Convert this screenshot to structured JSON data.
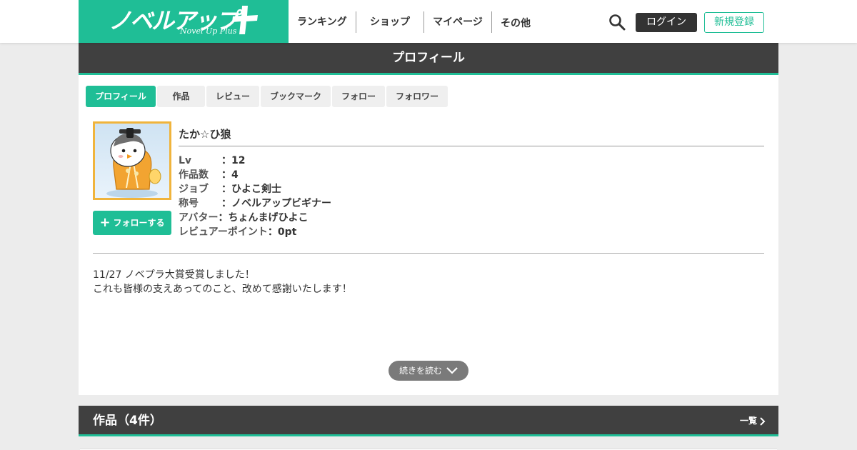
{
  "header": {
    "logo": {
      "main": "ノベルアップ",
      "sub": "Novel Up Plus"
    },
    "nav": [
      {
        "label": "ランキング"
      },
      {
        "label": "ショップ"
      },
      {
        "label": "マイページ"
      },
      {
        "label": "その他"
      }
    ],
    "login_label": "ログイン",
    "register_label": "新規登録",
    "accent_color": "#1fbe96"
  },
  "profile_header": {
    "title": "プロフィール"
  },
  "tabs": [
    {
      "label": "プロフィール",
      "active": true
    },
    {
      "label": "作品"
    },
    {
      "label": "レビュー"
    },
    {
      "label": "ブックマーク"
    },
    {
      "label": "フォロー"
    },
    {
      "label": "フォロワー"
    }
  ],
  "user": {
    "name": "たか☆ひ狼",
    "follow_label": "フォローする",
    "stats": [
      {
        "label": "Lv",
        "value": "：12"
      },
      {
        "label": "作品数",
        "value": "：4"
      },
      {
        "label": "ジョブ",
        "value": "：ひよこ剣士"
      },
      {
        "label": "称号",
        "value": "：ノベルアップビギナー"
      },
      {
        "label": "アバター",
        "value": "：ちょんまげひよこ"
      },
      {
        "label": "レビュアーポイント",
        "value": "：0pt"
      }
    ],
    "bio_lines": [
      "11/27 ノベプラ大賞受賞しました！",
      "これも皆様の支えあってのこと、改めて感謝いたします！"
    ],
    "read_more_label": "続きを読む"
  },
  "works": {
    "title": "作品（4件）",
    "list_link": "一覧"
  }
}
